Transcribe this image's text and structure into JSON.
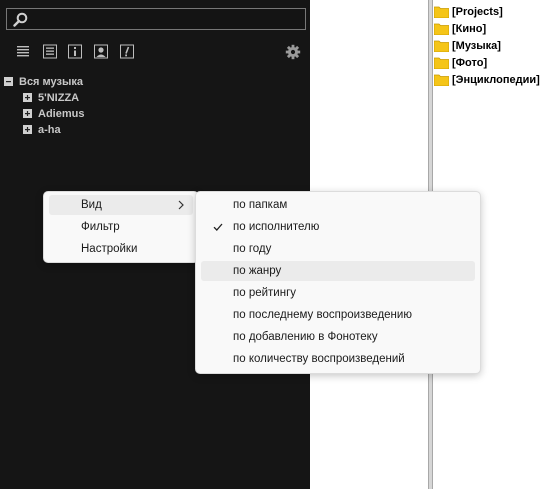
{
  "search": {
    "value": "",
    "placeholder": ""
  },
  "toolbar": {
    "icons": [
      "list-icon",
      "detailed-list-icon",
      "info-icon",
      "artist-icon",
      "lyrics-icon"
    ],
    "settings_icon": "gear-icon"
  },
  "tree": {
    "root_label": "Вся музыка",
    "root_toggle": "minus-box-icon",
    "items": [
      {
        "label": "5'NIZZA",
        "toggle": "plus-box-icon"
      },
      {
        "label": "Adiemus",
        "toggle": "plus-box-icon"
      },
      {
        "label": "a-ha",
        "toggle": "plus-box-icon"
      }
    ]
  },
  "folders": [
    {
      "label": "[Projects]"
    },
    {
      "label": "[Кино]"
    },
    {
      "label": "[Музыка]"
    },
    {
      "label": "[Фото]"
    },
    {
      "label": "[Энциклопедии]"
    }
  ],
  "context_menu": {
    "items": [
      {
        "label": "Вид",
        "has_submenu": true,
        "highlighted": true
      },
      {
        "label": "Фильтр"
      },
      {
        "label": "Настройки"
      }
    ]
  },
  "submenu": {
    "items": [
      {
        "label": "по папкам"
      },
      {
        "label": "по исполнителю",
        "checked": true
      },
      {
        "label": "по году"
      },
      {
        "label": "по жанру",
        "hovered": true
      },
      {
        "label": "по рейтингу"
      },
      {
        "label": "по последнему воспроизведению"
      },
      {
        "label": "по добавлению в Фонотеку"
      },
      {
        "label": "по количеству воспроизведений"
      }
    ]
  },
  "colors": {
    "panel_bg": "#151515",
    "tree_text": "#c8c8c8",
    "folder_yellow": "#f5c518",
    "menu_bg": "#f9f9f9",
    "menu_hover": "#ebebeb"
  }
}
